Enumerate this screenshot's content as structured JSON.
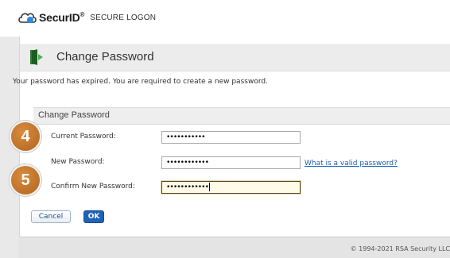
{
  "header": {
    "brand": "SecurID",
    "trademark": "®",
    "subtitle": "SECURE LOGON"
  },
  "panel": {
    "title": "Change Password",
    "expired_message": "Your password has expired. You are required to create a new password."
  },
  "form": {
    "section_title": "Change Password",
    "fields": [
      {
        "label": "Current Password:",
        "value": "•••••••••••"
      },
      {
        "label": "New Password:",
        "value": "••••••••••••"
      },
      {
        "label": "Confirm New Password:",
        "value": "••••••••••••"
      }
    ],
    "help_link": "What is a valid password?"
  },
  "buttons": {
    "cancel": "Cancel",
    "ok": "OK"
  },
  "steps": [
    "4",
    "5"
  ],
  "footer": {
    "copyright": "© 1994-2021 RSA Security LLC"
  },
  "colors": {
    "accent": "#1e63b8",
    "badge": "#c4742e"
  },
  "icons": {
    "logo": "cloud-logo-icon",
    "panel": "door-exit-icon"
  }
}
